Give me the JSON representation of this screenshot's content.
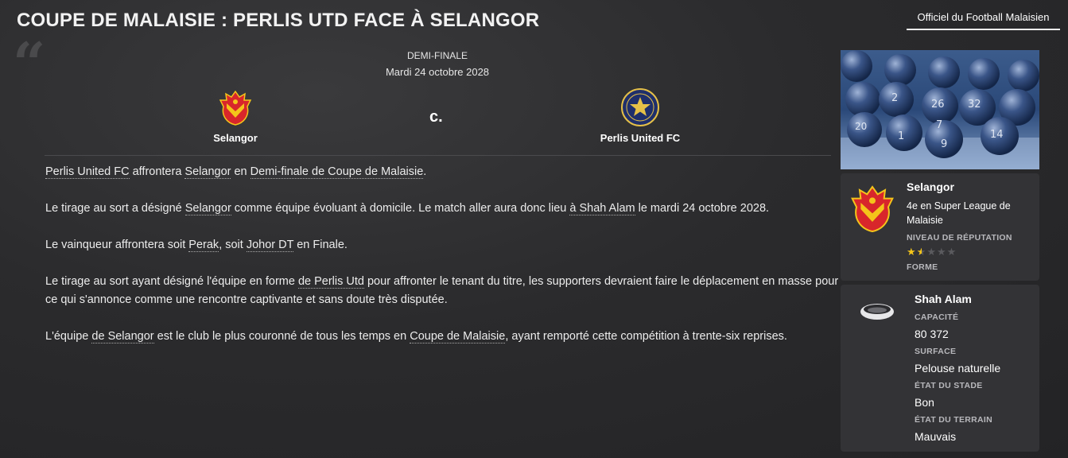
{
  "header": {
    "title": "COUPE DE MALAISIE : PERLIS UTD FACE À SELANGOR",
    "tab_label": "Officiel du Football Malaisien"
  },
  "match": {
    "stage": "DEMI-FINALE",
    "date": "Mardi 24 octobre 2028",
    "vs": "c.",
    "home": "Selangor",
    "away": "Perlis United FC"
  },
  "article": {
    "p1": {
      "t1": "Perlis United FC",
      "t2": " affrontera ",
      "t3": "Selangor",
      "t4": " en ",
      "t5": "Demi-finale de Coupe de Malaisie",
      "t6": "."
    },
    "p2": {
      "t1": "Le tirage au sort a désigné ",
      "t2": "Selangor",
      "t3": " comme équipe évoluant à domicile. Le match aller aura donc lieu ",
      "t4": "à Shah Alam",
      "t5": " le mardi 24 octobre 2028."
    },
    "p3": {
      "t1": "Le vainqueur affrontera soit ",
      "t2": "Perak",
      "t3": ", soit ",
      "t4": "Johor DT",
      "t5": " en Finale."
    },
    "p4": {
      "t1": "Le tirage au sort ayant désigné l'équipe en forme ",
      "t2": "de Perlis Utd",
      "t3": " pour affronter le tenant du titre, les supporters devraient faire le déplacement en masse pour ce qui s'annonce comme une rencontre captivante et sans doute très disputée."
    },
    "p5": {
      "t1": "L'équipe ",
      "t2": "de Selangor",
      "t3": " est le club le plus couronné de tous les temps en ",
      "t4": "Coupe de Malaisie",
      "t5": ", ayant remporté cette compétition à trente-six reprises."
    }
  },
  "side_image": {
    "ball_numbers": [
      "2",
      "26",
      "32",
      "7",
      "20",
      "14",
      "1",
      "9"
    ]
  },
  "club_card": {
    "name": "Selangor",
    "league_line1": "4e en Super League de",
    "league_line2": "Malaisie",
    "reputation_label": "NIVEAU DE RÉPUTATION",
    "reputation_stars": 1.5,
    "form_label": "FORME"
  },
  "stadium_card": {
    "name": "Shah Alam",
    "capacity_label": "CAPACITÉ",
    "capacity": "80 372",
    "surface_label": "SURFACE",
    "surface": "Pelouse naturelle",
    "stadium_state_label": "ÉTAT DU STADE",
    "stadium_state": "Bon",
    "pitch_state_label": "ÉTAT DU TERRAIN",
    "pitch_state": "Mauvais"
  },
  "colors": {
    "selangor_red": "#d8262b",
    "selangor_yellow": "#f4c51a",
    "perlis_blue": "#1f2f6b",
    "perlis_gold": "#e5c048",
    "star_filled": "#f4c51a",
    "star_empty": "#5a5a5e"
  }
}
